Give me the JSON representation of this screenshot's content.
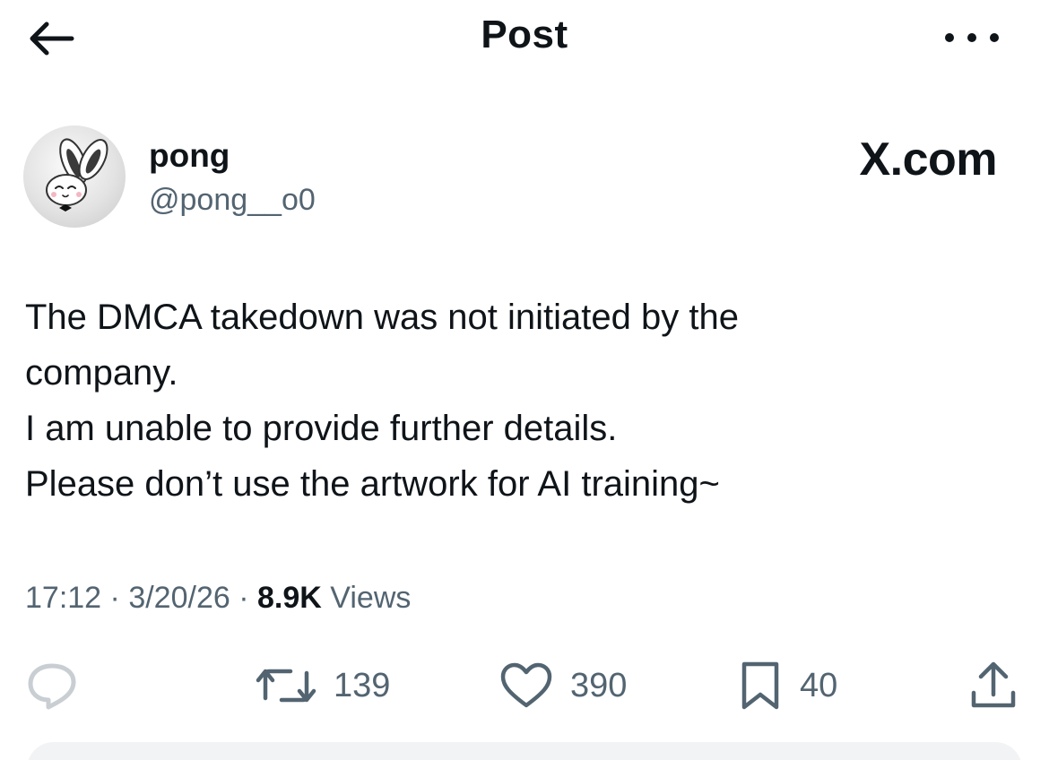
{
  "header": {
    "title": "Post"
  },
  "author": {
    "display_name": "pong",
    "handle": "@pong__o0",
    "avatar_icon": "bunny-avatar-icon"
  },
  "source_label": "X.com",
  "post": {
    "lines": [
      "The DMCA takedown was not initiated by the",
      "company.",
      "I am unable to provide further details.",
      "Please don’t use the artwork for AI training~"
    ]
  },
  "meta": {
    "time": "17:12",
    "separator": "·",
    "date": "3/20/26",
    "views_count": "8.9K",
    "views_label": "Views"
  },
  "actions": {
    "retweet_count": "139",
    "like_count": "390",
    "bookmark_count": "40"
  },
  "colors": {
    "text": "#0f1419",
    "secondary": "#536471",
    "reply_icon": "#c9ced3"
  }
}
